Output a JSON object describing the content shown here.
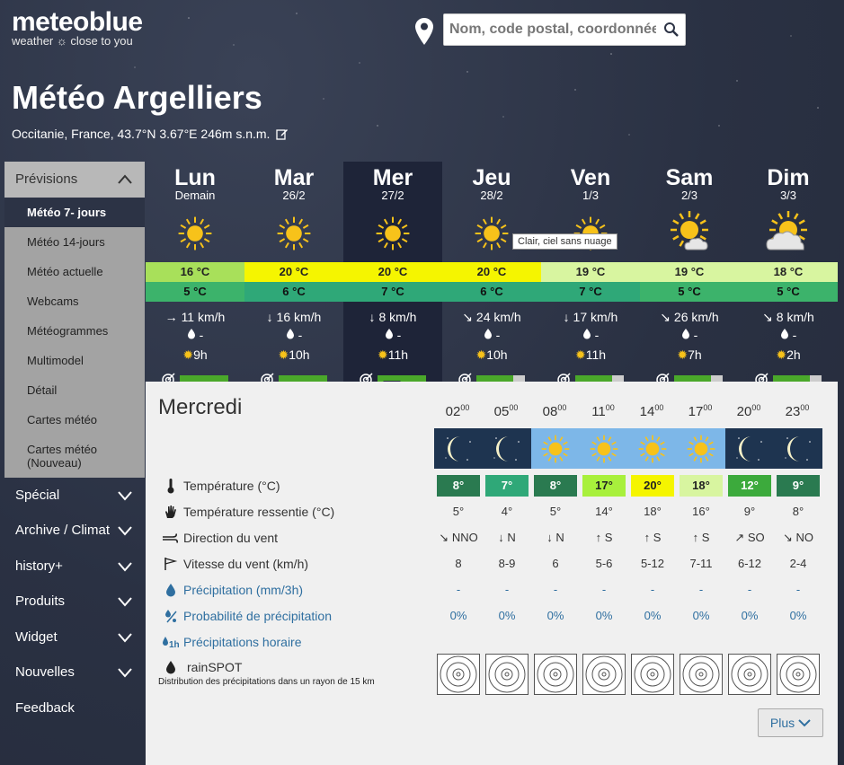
{
  "logo": {
    "name": "meteoblue",
    "tagline": "weather ☼ close to you"
  },
  "search": {
    "placeholder": "Nom, code postal, coordonnée"
  },
  "title": "Météo Argelliers",
  "location": "Occitanie, France, 43.7°N 3.67°E 246m s.n.m.",
  "sidebar": {
    "previsions": "Prévisions",
    "subitems": [
      {
        "label": "Météo 7- jours",
        "active": true
      },
      {
        "label": "Météo 14-jours"
      },
      {
        "label": "Météo actuelle"
      },
      {
        "label": "Webcams"
      },
      {
        "label": "Météogrammes"
      },
      {
        "label": "Multimodel"
      },
      {
        "label": "Détail"
      },
      {
        "label": "Cartes météo"
      },
      {
        "label": "Cartes météo (Nouveau)"
      }
    ],
    "sections": [
      "Spécial",
      "Archive / Climat",
      "history+",
      "Produits",
      "Widget",
      "Nouvelles",
      "Feedback"
    ]
  },
  "days": [
    {
      "name": "Lun",
      "date": "Demain",
      "icon": "sun-icon",
      "tmax": "16 °C",
      "tmax_color": "#a8e05a",
      "tmin": "5 °C",
      "tmin_color": "#3cb36b",
      "wind_dir": "→",
      "wind": "11 km/h",
      "precip": "-",
      "sun": "9h",
      "predictability": 1.0
    },
    {
      "name": "Mar",
      "date": "26/2",
      "icon": "sun-icon",
      "tmax": "20 °C",
      "tmax_color": "#f5f500",
      "tmin": "6 °C",
      "tmin_color": "#2fa878",
      "wind_dir": "↓",
      "wind": "16 km/h",
      "precip": "-",
      "sun": "10h",
      "predictability": 1.0
    },
    {
      "name": "Mer",
      "date": "27/2",
      "icon": "sun-icon",
      "tmax": "20 °C",
      "tmax_color": "#f5f500",
      "tmin": "7 °C",
      "tmin_color": "#2fa878",
      "wind_dir": "↓",
      "wind": "8 km/h",
      "precip": "-",
      "sun": "11h",
      "predictability": 1.0
    },
    {
      "name": "Jeu",
      "date": "28/2",
      "icon": "sun-icon",
      "tmax": "20 °C",
      "tmax_color": "#f5f500",
      "tmin": "6 °C",
      "tmin_color": "#2fa878",
      "wind_dir": "↘",
      "wind": "24 km/h",
      "precip": "-",
      "sun": "10h",
      "predictability": 0.75
    },
    {
      "name": "Ven",
      "date": "1/3",
      "icon": "sun-icon",
      "tmax": "19 °C",
      "tmax_color": "#d8f5a0",
      "tmin": "7 °C",
      "tmin_color": "#2fa878",
      "wind_dir": "↓",
      "wind": "17 km/h",
      "precip": "-",
      "sun": "11h",
      "predictability": 0.75
    },
    {
      "name": "Sam",
      "date": "2/3",
      "icon": "sun-cloud-icon",
      "tmax": "19 °C",
      "tmax_color": "#d8f5a0",
      "tmin": "5 °C",
      "tmin_color": "#3cb36b",
      "wind_dir": "↘",
      "wind": "26 km/h",
      "precip": "-",
      "sun": "7h",
      "predictability": 0.75
    },
    {
      "name": "Dim",
      "date": "3/3",
      "icon": "cloud-sun-icon",
      "tmax": "18 °C",
      "tmax_color": "#d8f5a0",
      "tmin": "5 °C",
      "tmin_color": "#3cb36b",
      "wind_dir": "↘",
      "wind": "8 km/h",
      "precip": "-",
      "sun": "2h",
      "predictability": 0.75
    }
  ],
  "tooltip": "Clair, ciel sans nuage",
  "detail": {
    "day": "Mercredi",
    "hours": [
      "02",
      "05",
      "08",
      "11",
      "14",
      "17",
      "20",
      "23"
    ],
    "hours_sup": "00",
    "icons": [
      "moon-icon",
      "moon-icon",
      "sun-icon",
      "sun-icon",
      "sun-icon",
      "sun-icon",
      "moon-icon",
      "moon-icon"
    ],
    "rows": {
      "temperature": {
        "label": "Température (°C)",
        "values": [
          "8°",
          "7°",
          "8°",
          "17°",
          "20°",
          "18°",
          "12°",
          "9°"
        ],
        "colors": [
          "#2a7a50",
          "#2fa878",
          "#2a7a50",
          "#a8f03c",
          "#f5f500",
          "#d8f5a0",
          "#3caa3c",
          "#2a7a50"
        ],
        "text_colors": [
          "#fff",
          "#fff",
          "#fff",
          "#222",
          "#222",
          "#222",
          "#fff",
          "#fff"
        ]
      },
      "felt": {
        "label": "Température ressentie (°C)",
        "values": [
          "5°",
          "4°",
          "5°",
          "14°",
          "18°",
          "16°",
          "9°",
          "8°"
        ]
      },
      "wind_dir": {
        "label": "Direction du vent",
        "arrows": [
          "↘",
          "↓",
          "↓",
          "↑",
          "↑",
          "↑",
          "↗",
          "↘"
        ],
        "values": [
          "NNO",
          "N",
          "N",
          "S",
          "S",
          "S",
          "SO",
          "NO"
        ]
      },
      "wind_speed": {
        "label": "Vitesse du vent (km/h)",
        "values": [
          "8",
          "8-9",
          "6",
          "5-6",
          "5-12",
          "7-11",
          "6-12",
          "2-4"
        ]
      },
      "precipitation": {
        "label": "Précipitation (mm/3h)",
        "values": [
          "-",
          "-",
          "-",
          "-",
          "-",
          "-",
          "-",
          "-"
        ]
      },
      "probability": {
        "label": "Probabilité de précipitation",
        "values": [
          "0%",
          "0%",
          "0%",
          "0%",
          "0%",
          "0%",
          "0%",
          "0%"
        ]
      },
      "hourly": {
        "label": "Précipitations horaire"
      },
      "rainspot": {
        "label": "rainSPOT",
        "sub": "Distribution des précipitations dans un rayon de 15 km"
      }
    },
    "more": "Plus"
  }
}
